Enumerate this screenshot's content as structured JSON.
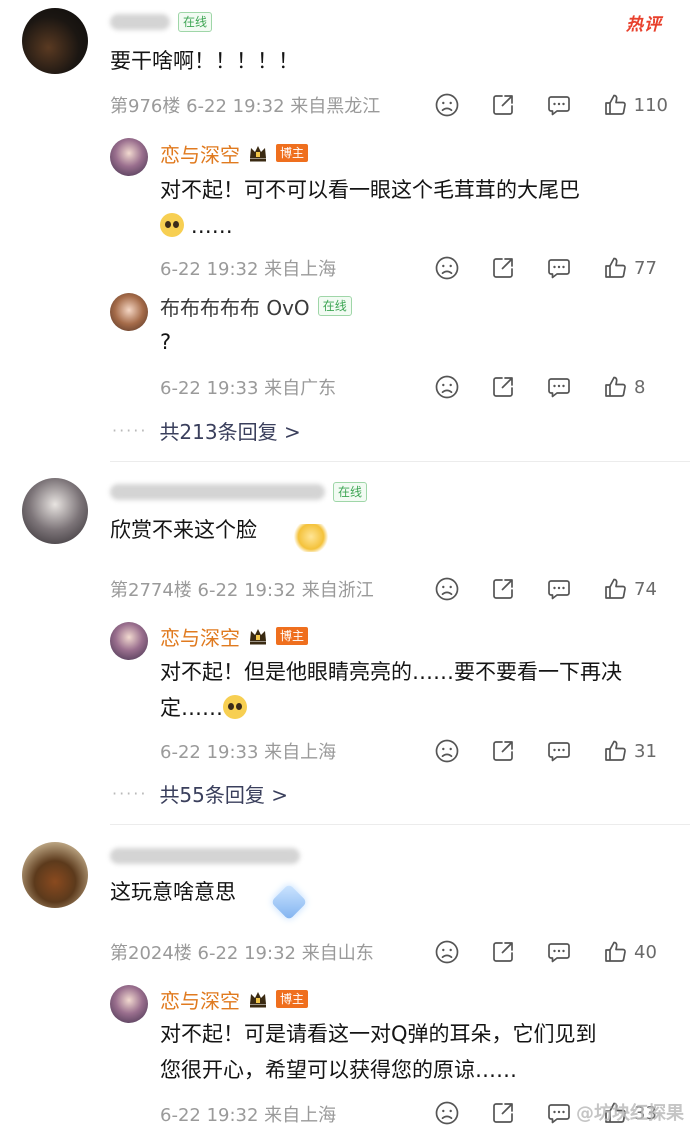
{
  "hot_label": "热评",
  "online_label": "在线",
  "boss_label": "博主",
  "threads": [
    {
      "text": "要干啥啊！！！！！",
      "floor": "第976楼 6-22 19:32 来自黑龙江",
      "likes": "110",
      "reply": {
        "author": "恋与深空",
        "text_line1": "对不起！可不可以看一眼这个毛茸茸的大尾巴",
        "text_line2": "……",
        "meta": "6-22 19:32 来自上海",
        "likes": "77"
      },
      "reply2": {
        "author": "布布布布布 OvO",
        "text": "?",
        "meta": "6-22 19:33 来自广东",
        "likes": "8"
      },
      "more": "共213条回复 >"
    },
    {
      "text": "欣赏不来这个脸",
      "floor": "第2774楼 6-22 19:32 来自浙江",
      "likes": "74",
      "reply": {
        "author": "恋与深空",
        "text_line1": "对不起！但是他眼睛亮亮的……要不要看一下再决",
        "text_line2": "定……",
        "meta": "6-22 19:33 来自上海",
        "likes": "31"
      },
      "more": "共55条回复 >"
    },
    {
      "text": "这玩意啥意思",
      "floor": "第2024楼 6-22 19:32 来自山东",
      "likes": "40",
      "reply": {
        "author": "恋与深空",
        "text_line1": "对不起！可是请看这一对Q弹的耳朵，它们见到",
        "text_line2": "您很开心，希望可以获得您的原谅……",
        "meta": "6-22 19:32 来自上海",
        "likes": "33"
      }
    }
  ],
  "watermark": "@坊块红探果"
}
